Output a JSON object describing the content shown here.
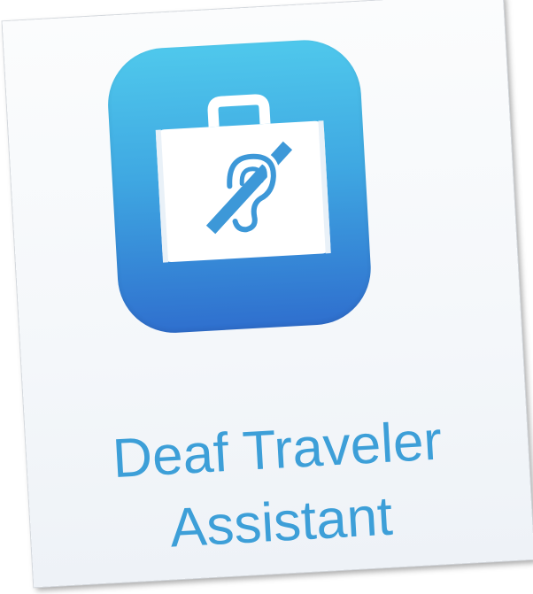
{
  "app": {
    "name_line1": "Deaf Traveler",
    "name_line2": "Assistant"
  },
  "icon": {
    "name": "suitcase-deaf-symbol-icon",
    "gradient_top": "#4fc8ec",
    "gradient_bottom": "#2f6fce"
  },
  "colors": {
    "title_text": "#3d9fd8",
    "background": "#f4f7fa"
  }
}
